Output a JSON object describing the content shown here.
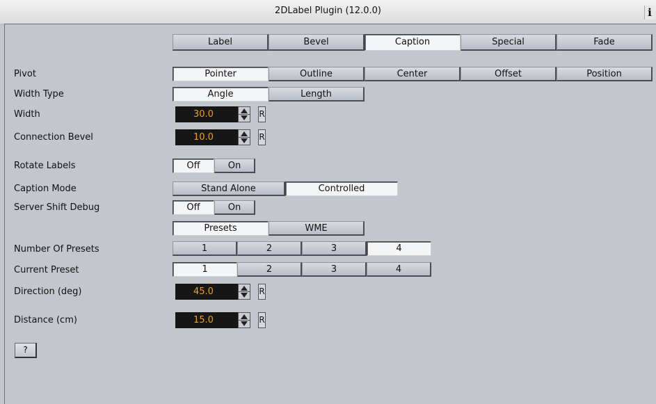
{
  "title": "2DLabel Plugin (12.0.0)",
  "info_glyph": "i",
  "tabs": [
    "Label",
    "Bevel",
    "Caption",
    "Special",
    "Fade"
  ],
  "rows": {
    "pivot": {
      "label": "Pivot",
      "options": [
        "Pointer",
        "Outline",
        "Center",
        "Offset",
        "Position"
      ]
    },
    "width_type": {
      "label": "Width Type",
      "options": [
        "Angle",
        "Length"
      ]
    },
    "width": {
      "label": "Width",
      "value": "30.0"
    },
    "connection_bevel": {
      "label": "Connection Bevel",
      "value": "10.0"
    },
    "rotate_labels": {
      "label": "Rotate Labels",
      "options": [
        "Off",
        "On"
      ]
    },
    "caption_mode": {
      "label": "Caption Mode",
      "options": [
        "Stand Alone",
        "Controlled"
      ]
    },
    "server_shift_debug": {
      "label": "Server Shift Debug",
      "options": [
        "Off",
        "On"
      ]
    },
    "preset_tabs": {
      "options": [
        "Presets",
        "WME"
      ]
    },
    "number_of_presets": {
      "label": "Number Of Presets",
      "options": [
        "1",
        "2",
        "3",
        "4"
      ]
    },
    "current_preset": {
      "label": "Current Preset",
      "options": [
        "1",
        "2",
        "3",
        "4"
      ]
    },
    "direction": {
      "label": "Direction (deg)",
      "value": "45.0"
    },
    "distance": {
      "label": "Distance (cm)",
      "value": "15.0"
    }
  },
  "reset_label": "R",
  "help_label": "?"
}
